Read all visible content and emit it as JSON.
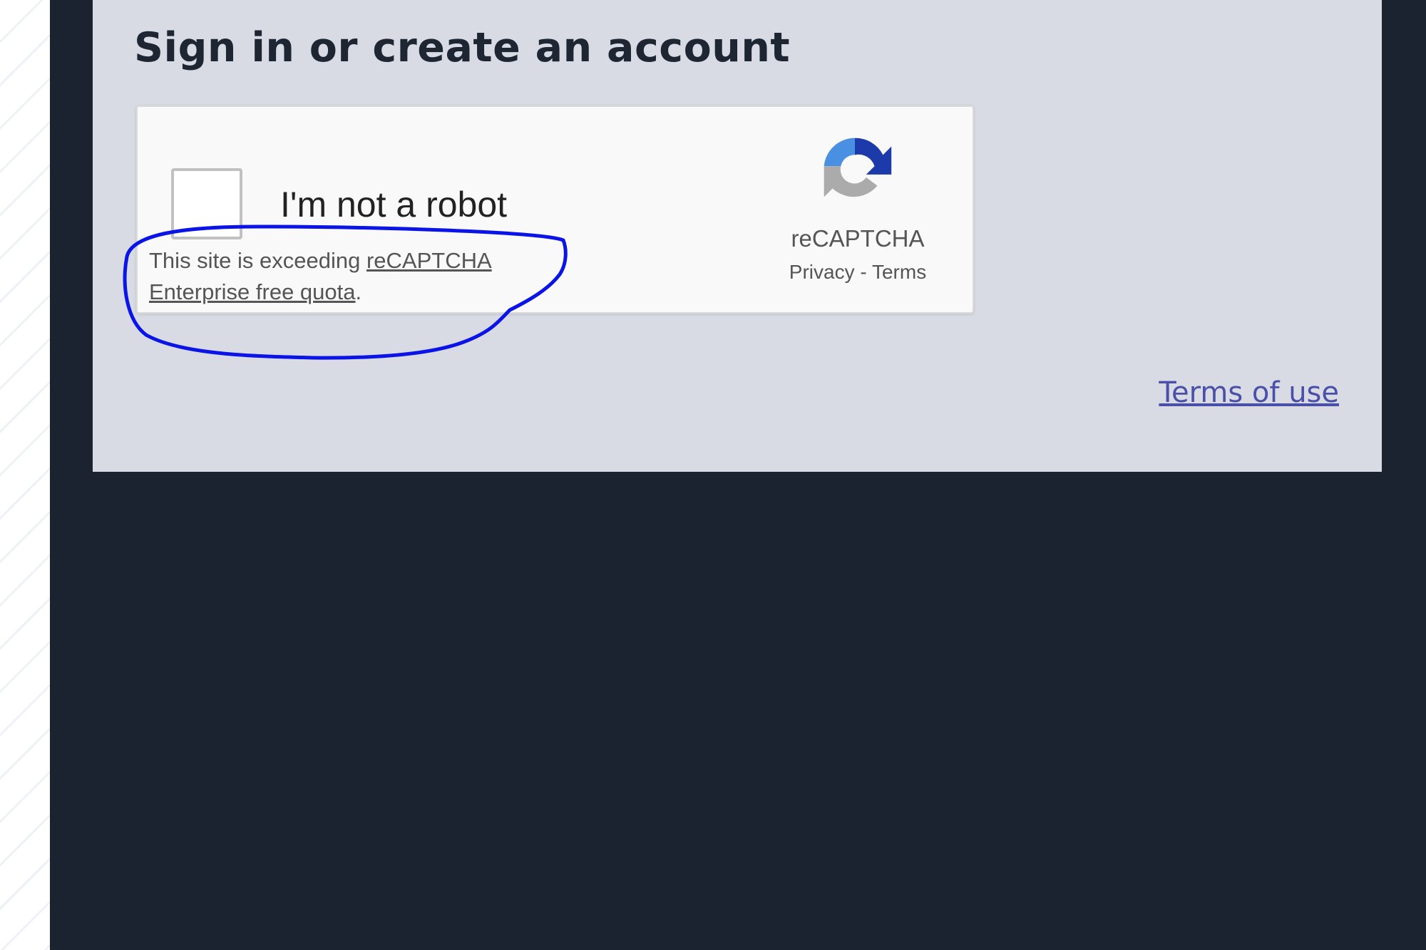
{
  "page": {
    "title": "Sign in or create an account",
    "terms_of_use_link": "Terms of use"
  },
  "captcha": {
    "checkbox_label": "I'm not a robot",
    "quota_message_prefix": "This site is exceeding ",
    "quota_link_line1": "reCAPTCHA",
    "quota_link_line2": "Enterprise free quota",
    "quota_message_suffix": ".",
    "brand": "reCAPTCHA",
    "privacy_link": "Privacy",
    "separator": " - ",
    "terms_link": "Terms",
    "checked": false
  },
  "colors": {
    "panel_bg": "#d8dbe3",
    "page_bg": "#1b2330",
    "link": "#4a4fa8",
    "annotation": "#0a14e6"
  },
  "icons": {
    "recaptcha": "recaptcha-logo-icon"
  }
}
